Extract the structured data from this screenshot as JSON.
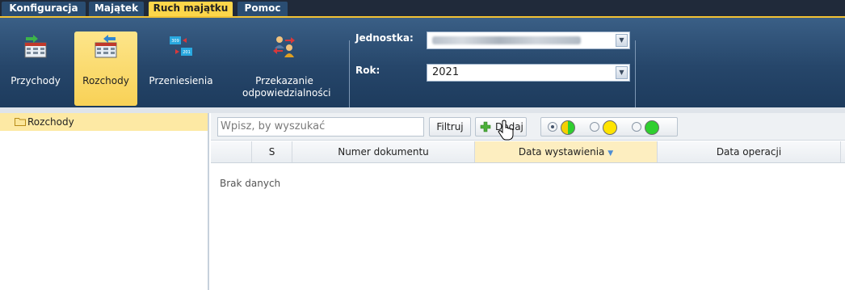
{
  "menu": {
    "items": [
      {
        "label": "Konfiguracja",
        "active": false
      },
      {
        "label": "Majątek",
        "active": false
      },
      {
        "label": "Ruch majątku",
        "active": true
      },
      {
        "label": "Pomoc",
        "active": false
      }
    ]
  },
  "ribbon": {
    "buttons": [
      {
        "label": "Przychody",
        "icon": "income-table-icon",
        "active": false
      },
      {
        "label": "Rozchody",
        "icon": "expense-table-icon",
        "active": true
      },
      {
        "label": "Przeniesienia",
        "icon": "transfer-icon",
        "active": false
      },
      {
        "label": "Przekazanie odpowiedzialności",
        "icon": "handover-people-icon",
        "active": false
      }
    ]
  },
  "filters": {
    "jednostka_label": "Jednostka:",
    "rok_label": "Rok:",
    "rok_value": "2021"
  },
  "sidebar": {
    "tree": [
      {
        "label": "Rozchody",
        "icon": "folder-icon",
        "selected": true
      }
    ]
  },
  "toolbar": {
    "search_placeholder": "Wpisz, by wyszukać",
    "filter_label": "Filtruj",
    "add_label": "Dodaj",
    "status_colors": {
      "half": "#f5d000",
      "yellow": "#ffe400",
      "green": "#2fcf2f"
    }
  },
  "grid": {
    "columns": [
      "",
      "S",
      "Numer dokumentu",
      "Data wystawienia",
      "Data operacji",
      ""
    ],
    "sorted_column": "Data wystawienia",
    "empty_text": "Brak danych"
  },
  "colors": {
    "accent": "#fdd64a",
    "ribbon": "#26466a",
    "menubar": "#202a3a"
  }
}
